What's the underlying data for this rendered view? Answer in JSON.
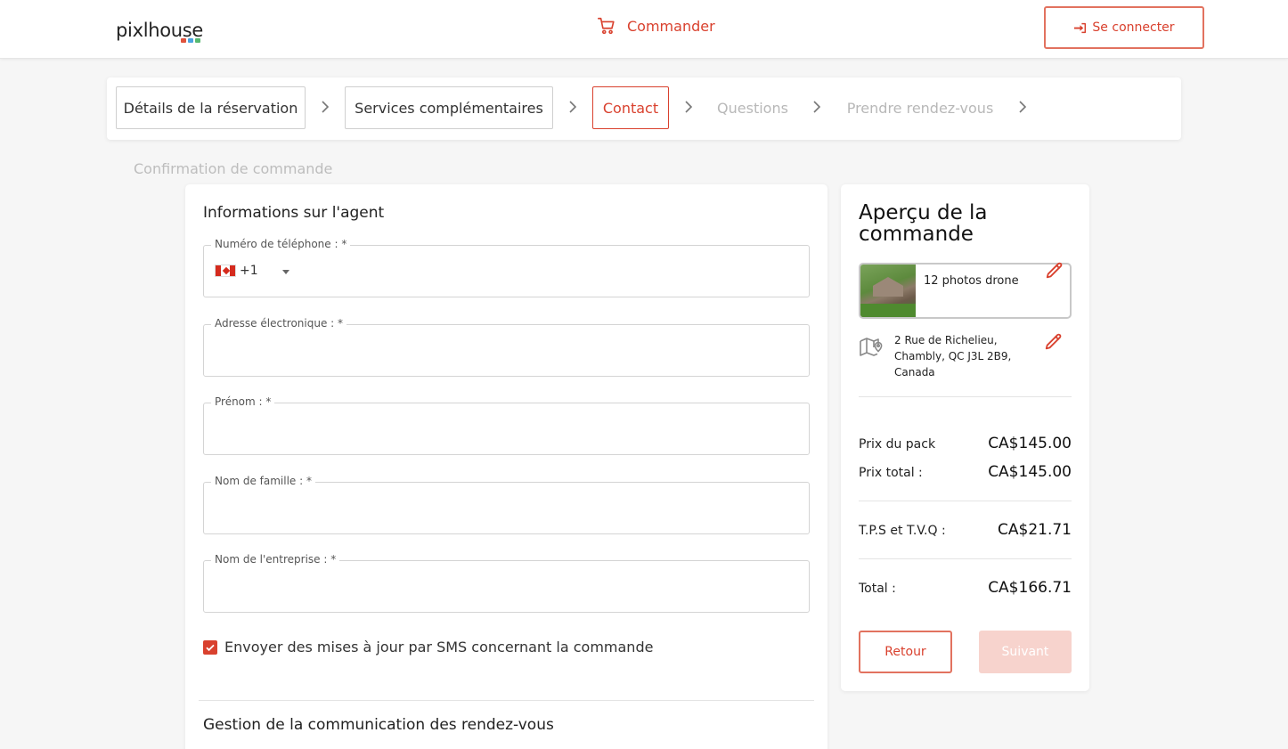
{
  "header": {
    "logo_text": "pixlhouse",
    "logo_dot_colors": [
      "#e0533d",
      "#4aa3df",
      "#56b870"
    ],
    "order_label": "Commander",
    "login_label": "Se connecter"
  },
  "stepper": {
    "steps": [
      {
        "label": "Détails de la réservation",
        "state": "done"
      },
      {
        "label": "Services complémentaires",
        "state": "done"
      },
      {
        "label": "Contact",
        "state": "active"
      },
      {
        "label": "Questions",
        "state": "todo"
      },
      {
        "label": "Prendre rendez-vous",
        "state": "todo"
      },
      {
        "label": "Confirmation de commande",
        "state": "todo"
      }
    ]
  },
  "form": {
    "section_title": "Informations sur l'agent",
    "fields": {
      "phone_label": "Numéro de téléphone : *",
      "phone_country_code": "+1",
      "email_label": "Adresse électronique : *",
      "first_name_label": "Prénom : *",
      "last_name_label": "Nom de famille : *",
      "company_label": "Nom de l'entreprise : *"
    },
    "sms_label": "Envoyer des mises à jour par SMS concernant la commande",
    "sms_checked": true,
    "section2_title": "Gestion de la communication des rendez-vous"
  },
  "summary": {
    "title": "Aperçu de la commande",
    "product_name": "12 photos drone",
    "address": "2 Rue de Richelieu, Chambly, QC J3L 2B9, Canada",
    "pack_price_label": "Prix du pack",
    "pack_price": "CA$145.00",
    "total_price_label": "Prix total :",
    "total_price": "CA$145.00",
    "tax_label": "T.P.S et T.V.Q :",
    "tax": "CA$21.71",
    "grand_total_label": "Total :",
    "grand_total": "CA$166.71",
    "back_label": "Retour",
    "next_label": "Suivant"
  },
  "colors": {
    "accent": "#d9412e",
    "accent_light": "#f7d3cd"
  }
}
